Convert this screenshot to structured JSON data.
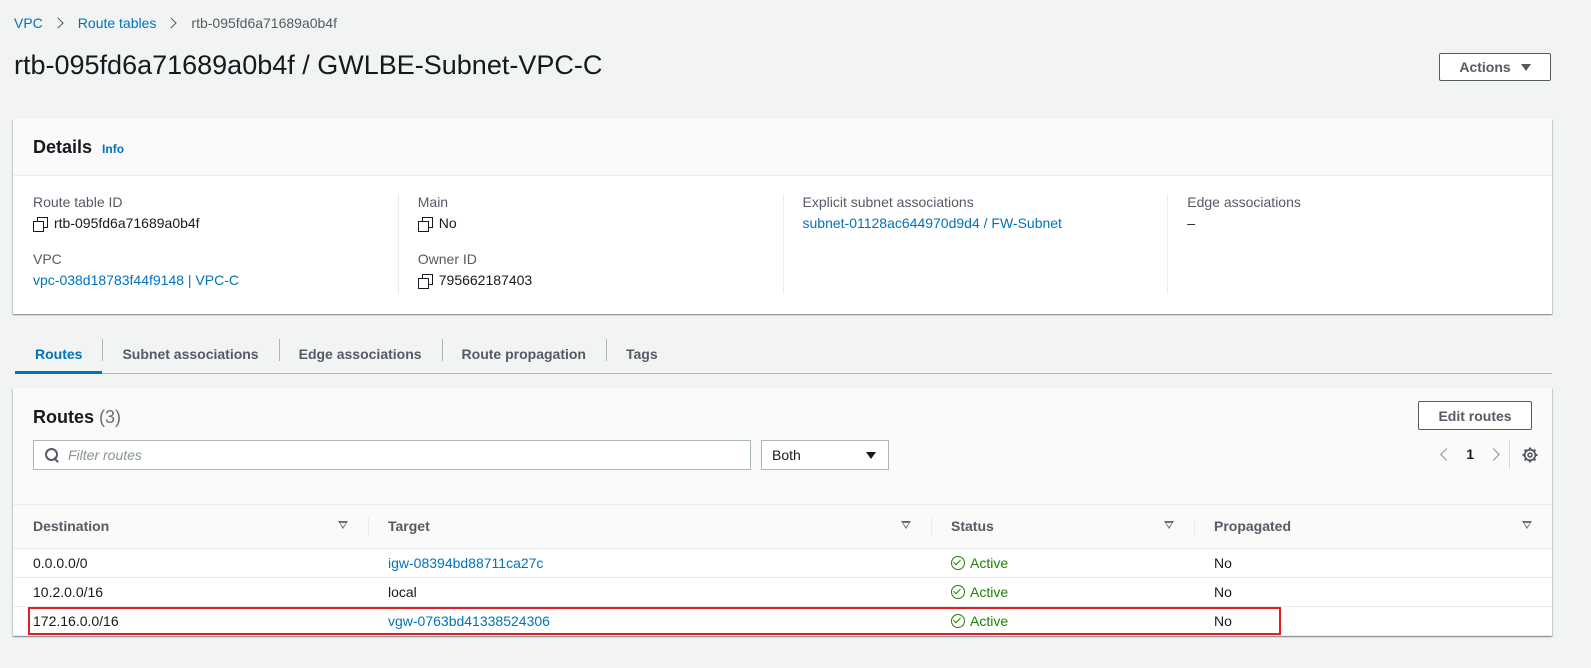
{
  "breadcrumb": {
    "items": [
      "VPC",
      "Route tables"
    ],
    "current": "rtb-095fd6a71689a0b4f"
  },
  "page": {
    "title": "rtb-095fd6a71689a0b4f / GWLBE-Subnet-VPC-C",
    "actions_label": "Actions"
  },
  "details": {
    "title": "Details",
    "info_label": "Info",
    "route_table_id": {
      "label": "Route table ID",
      "value": "rtb-095fd6a71689a0b4f"
    },
    "vpc": {
      "label": "VPC",
      "value": "vpc-038d18783f44f9148 | VPC-C"
    },
    "main": {
      "label": "Main",
      "value": "No"
    },
    "owner_id": {
      "label": "Owner ID",
      "value": "795662187403"
    },
    "explicit_subnet": {
      "label": "Explicit subnet associations",
      "value": "subnet-01128ac644970d9d4 / FW-Subnet"
    },
    "edge": {
      "label": "Edge associations",
      "value": "–"
    }
  },
  "tabs": [
    "Routes",
    "Subnet associations",
    "Edge associations",
    "Route propagation",
    "Tags"
  ],
  "routes": {
    "title": "Routes",
    "count": "(3)",
    "edit_label": "Edit routes",
    "filter_placeholder": "Filter routes",
    "select_value": "Both",
    "page": "1",
    "columns": [
      "Destination",
      "Target",
      "Status",
      "Propagated"
    ],
    "rows": [
      {
        "destination": "0.0.0.0/0",
        "target": "igw-08394bd88711ca27c",
        "status": "Active",
        "propagated": "No"
      },
      {
        "destination": "10.2.0.0/16",
        "target": "local",
        "status": "Active",
        "propagated": "No"
      },
      {
        "destination": "172.16.0.0/16",
        "target": "vgw-0763bd41338524306",
        "status": "Active",
        "propagated": "No"
      }
    ]
  },
  "colors": {
    "link": "#0073bb",
    "success": "#1d8102",
    "highlight": "#e01f27"
  }
}
